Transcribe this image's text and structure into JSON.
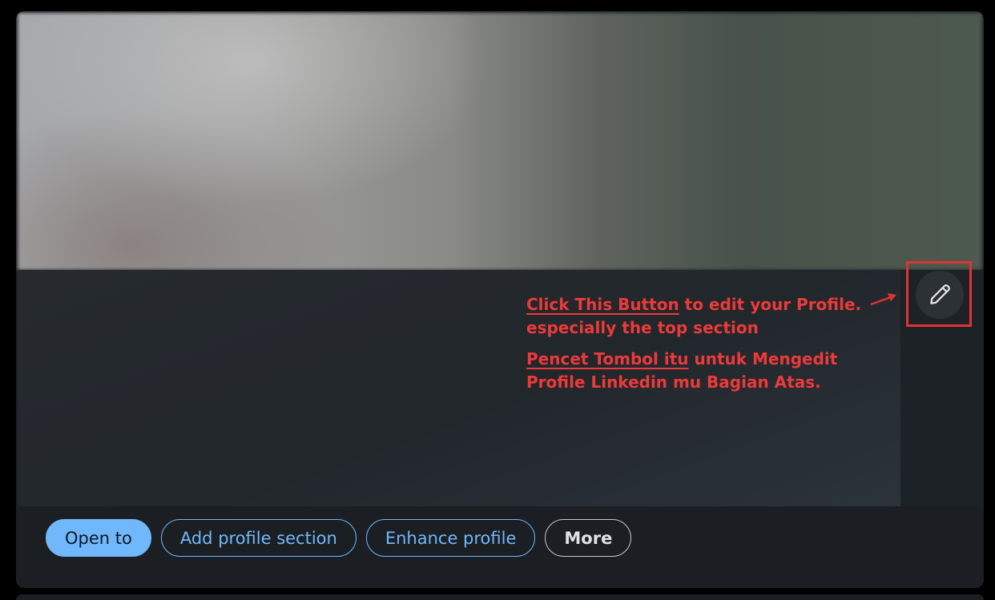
{
  "profile": {
    "edit_button_icon": "pencil-icon",
    "actions": {
      "open_to": "Open to",
      "add_profile_section": "Add profile section",
      "enhance_profile": "Enhance profile",
      "more": "More"
    }
  },
  "annotation": {
    "line1_link": "Click This Button",
    "line1_rest": " to edit your Profile.",
    "line2": "especially the top section",
    "line3_link": "Pencet Tombol itu",
    "line3_rest": " untuk Mengedit",
    "line4": "Profile Linkedin mu Bagian Atas.",
    "color": "#ec3a3a"
  },
  "colors": {
    "accent": "#71b7fb",
    "card_bg": "#1b1f23",
    "highlight": "#e23232"
  }
}
